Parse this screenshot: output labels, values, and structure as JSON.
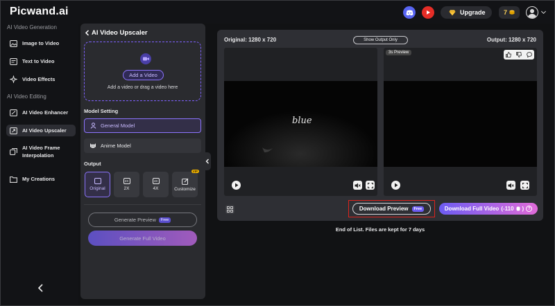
{
  "app": {
    "logo_main": "Picwand",
    "logo_suffix": ".ai"
  },
  "topbar": {
    "discord_icon": "discord-icon",
    "youtube_icon": "youtube-icon",
    "upgrade_label": "Upgrade",
    "credits": "7",
    "brand_color": "#6d5cf2"
  },
  "sidebar": {
    "section_generation": "AI Video Generation",
    "section_editing": "AI Video Editing",
    "items": [
      {
        "label": "Image to Video",
        "icon": "image-icon"
      },
      {
        "label": "Text to Video",
        "icon": "text-icon"
      },
      {
        "label": "Video Effects",
        "icon": "effects-icon"
      },
      {
        "label": "AI Video Enhancer",
        "icon": "enhancer-icon"
      },
      {
        "label": "AI Video Upscaler",
        "icon": "upscaler-icon",
        "active": true
      },
      {
        "label": "AI Video Frame Interpolation",
        "icon": "frame-icon"
      },
      {
        "label": "My Creations",
        "icon": "folder-icon"
      }
    ]
  },
  "panel": {
    "title": "AI Video Upscaler",
    "add_button": "Add a Video",
    "drop_hint": "Add a video or drag a video here",
    "model_label": "Model Setting",
    "model_general": "General Model",
    "model_anime": "Anime Model",
    "output_label": "Output",
    "outputs": [
      {
        "label": "Original",
        "icon_text": "",
        "selected": true
      },
      {
        "label": "2X",
        "icon_text": "2X"
      },
      {
        "label": "4X",
        "icon_text": "4X"
      },
      {
        "label": "Customize",
        "icon_text": "",
        "vip": "VIP"
      }
    ],
    "generate_preview": "Generate Preview",
    "free_badge": "Free",
    "generate_full": "Generate Full Video"
  },
  "main": {
    "original_caption": "Original: 1280 x 720",
    "show_output_only": "Show Output Only",
    "output_caption": "Output: 1280 x 720",
    "preview_tag": "3s Preview",
    "video_text": "blue",
    "download_preview": "Download Preview",
    "download_preview_badge": "Free",
    "download_full": "Download Full Video",
    "download_full_cost": "(-110",
    "download_full_cost_end": ")",
    "end_note": "End of List. Files are kept for 7 days"
  }
}
